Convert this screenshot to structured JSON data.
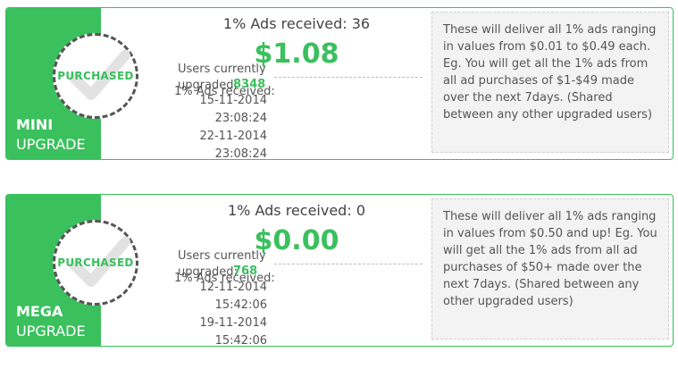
{
  "cards": [
    {
      "stamp": "PURCHASED",
      "tier_line1": "MINI",
      "tier_line2": "UPGRADE",
      "ads_title": "1% Ads received: 36",
      "price": "$1.08",
      "users_label": "Users currently upgraded:",
      "users_count": "8348",
      "received_label": "1% Ads received:",
      "dates": [
        "15-11-2014",
        "23:08:24",
        "22-11-2014",
        "23:08:24"
      ],
      "description": "These will deliver all 1% ads ranging in values from $0.01 to $0.49 each. Eg. You will get all the 1% ads from all ad purchases of $1-$49 made over the next 7days. (Shared between any other upgraded users)"
    },
    {
      "stamp": "PURCHASED",
      "tier_line1": "MEGA",
      "tier_line2": "UPGRADE",
      "ads_title": "1% Ads received: 0",
      "price": "$0.00",
      "users_label": "Users currently upgraded:",
      "users_count": "768",
      "received_label": "1% Ads received:",
      "dates": [
        "12-11-2014",
        "15:42:06",
        "19-11-2014",
        "15:42:06"
      ],
      "description": "These will deliver all 1% ads ranging in values from $0.50 and up! Eg. You will get all the 1% ads from all ad purchases of $50+ made over the next 7days. (Shared between any other upgraded users)"
    }
  ],
  "colors": {
    "accent": "#3ac05d",
    "panel": "#f3f3f3"
  }
}
